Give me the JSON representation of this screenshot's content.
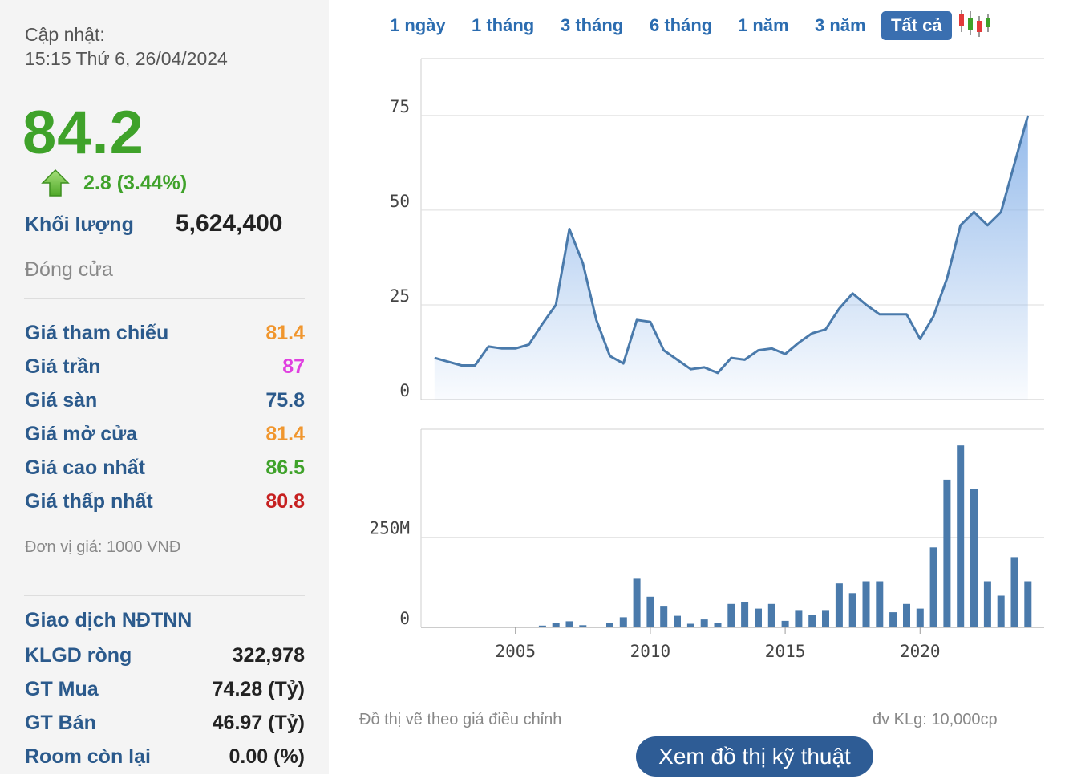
{
  "sidebar": {
    "updated_label": "Cập nhật:",
    "updated_time": "15:15 Thứ 6, 26/04/2024",
    "price": "84.2",
    "change": "2.8 (3.44%)",
    "volume_label": "Khối lượng",
    "volume_value": "5,624,400",
    "close_label": "Đóng cửa",
    "stats": [
      {
        "label": "Giá tham chiếu",
        "value": "81.4",
        "color": "#f0962e"
      },
      {
        "label": "Giá trần",
        "value": "87",
        "color": "#e040e0"
      },
      {
        "label": "Giá sàn",
        "value": "75.8",
        "color": "#2b5a8c"
      },
      {
        "label": "Giá mở cửa",
        "value": "81.4",
        "color": "#f0962e"
      },
      {
        "label": "Giá cao nhất",
        "value": "86.5",
        "color": "#3fa22a"
      },
      {
        "label": "Giá thấp nhất",
        "value": "80.8",
        "color": "#c62020"
      }
    ],
    "unit_note": "Đơn vị giá: 1000 VNĐ",
    "foreign_title": "Giao dịch NĐTNN",
    "foreign": [
      {
        "label": "KLGD ròng",
        "value": "322,978"
      },
      {
        "label": "GT Mua",
        "value": "74.28 (Tỷ)"
      },
      {
        "label": "GT Bán",
        "value": "46.97 (Tỷ)"
      },
      {
        "label": "Room còn lại",
        "value": "0.00 (%)"
      }
    ]
  },
  "tabs": [
    "1 ngày",
    "1 tháng",
    "3 tháng",
    "6 tháng",
    "1 năm",
    "3 năm",
    "Tất cả"
  ],
  "active_tab": "Tất cả",
  "notes": {
    "left": "Đồ thị vẽ theo giá điều chỉnh",
    "right": "đv KLg: 10,000cp"
  },
  "tech_button": "Xem đồ thị kỹ thuật",
  "colors": {
    "line": "#4a7aab",
    "bar": "#4a7aab",
    "up": "#3fa22a",
    "accent": "#2e5c95"
  },
  "chart_data": [
    {
      "type": "area",
      "y_ticks": [
        0,
        25,
        50,
        75
      ],
      "ylim": [
        0,
        90
      ],
      "x_ticks": [
        2005,
        2010,
        2015,
        2020
      ],
      "xlim": [
        2001.5,
        2024.6
      ],
      "grid": true,
      "x": [
        2002.0,
        2002.5,
        2003.0,
        2003.5,
        2004.0,
        2004.5,
        2005.0,
        2005.5,
        2006.0,
        2006.5,
        2007.0,
        2007.5,
        2008.0,
        2008.5,
        2009.0,
        2009.5,
        2010.0,
        2010.5,
        2011.0,
        2011.5,
        2012.0,
        2012.5,
        2013.0,
        2013.5,
        2014.0,
        2014.5,
        2015.0,
        2015.5,
        2016.0,
        2016.5,
        2017.0,
        2017.5,
        2018.0,
        2018.5,
        2019.0,
        2019.5,
        2020.0,
        2020.5,
        2021.0,
        2021.5,
        2022.0,
        2022.5,
        2023.0,
        2024.0
      ],
      "y": [
        11,
        10,
        9,
        9,
        14,
        13.5,
        13.5,
        14.5,
        20,
        25,
        45,
        36,
        21,
        11.5,
        9.5,
        21,
        20.5,
        13,
        10.5,
        8,
        8.5,
        7,
        11,
        10.5,
        13,
        13.5,
        12,
        15,
        17.5,
        18.5,
        24,
        28,
        25,
        22.5,
        22.5,
        22.5,
        16,
        22,
        32,
        46,
        49.5,
        46,
        49.5,
        75
      ]
    },
    {
      "type": "bar",
      "y_ticks": [
        0,
        250
      ],
      "y_tick_labels": [
        "0",
        "250M"
      ],
      "ylim": [
        0,
        550
      ],
      "x": [
        2006.0,
        2006.5,
        2007.0,
        2007.5,
        2008.5,
        2009.0,
        2009.5,
        2010.0,
        2010.5,
        2011.0,
        2011.5,
        2012.0,
        2012.5,
        2013.0,
        2013.5,
        2014.0,
        2014.5,
        2015.0,
        2015.5,
        2016.0,
        2016.5,
        2017.0,
        2017.5,
        2018.0,
        2018.5,
        2019.0,
        2019.5,
        2020.0,
        2020.5,
        2021.0,
        2021.5,
        2022.0,
        2022.5,
        2023.0,
        2023.5,
        2024.0
      ],
      "values": [
        5,
        12,
        17,
        6,
        12,
        28,
        135,
        85,
        60,
        32,
        10,
        22,
        13,
        65,
        70,
        52,
        65,
        18,
        48,
        35,
        48,
        122,
        95,
        128,
        128,
        42,
        65,
        52,
        222,
        410,
        505,
        385,
        128,
        88,
        195,
        128
      ]
    }
  ]
}
